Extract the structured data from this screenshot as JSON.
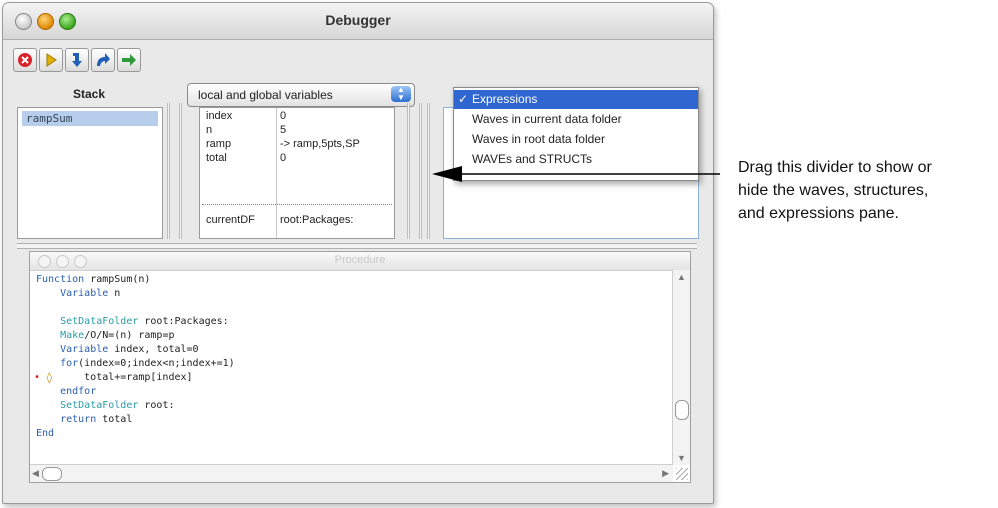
{
  "window": {
    "title": "Debugger"
  },
  "toolbar": {
    "buttons": [
      {
        "icon": "stop-icon",
        "color": "#d8232a"
      },
      {
        "icon": "go-icon",
        "color": "#e0b000"
      },
      {
        "icon": "step-into-icon",
        "color": "#1f5fb5"
      },
      {
        "icon": "step-over-icon",
        "color": "#1f5fb5"
      },
      {
        "icon": "step-out-icon",
        "color": "#2f9a3a"
      }
    ]
  },
  "stack": {
    "header": "Stack",
    "items": [
      "rampSum"
    ]
  },
  "variables": {
    "popup_value": "local and global variables",
    "rows": [
      {
        "name": "index",
        "value": "0"
      },
      {
        "name": "n",
        "value": "5"
      },
      {
        "name": "ramp",
        "value": "-> ramp,5pts,SP"
      },
      {
        "name": "total",
        "value": "0"
      },
      {
        "name": "currentDF",
        "value": "root:Packages:"
      }
    ]
  },
  "pane_menu": {
    "items": [
      {
        "label": "Expressions",
        "checked": true
      },
      {
        "label": "Waves in current data folder",
        "checked": false
      },
      {
        "label": "Waves in root data folder",
        "checked": false
      },
      {
        "label": "WAVEs and STRUCTs",
        "checked": false
      }
    ],
    "check_mark": "✓"
  },
  "procedure": {
    "title": "Procedure",
    "lines": [
      "Function rampSum(n)",
      "    Variable n",
      "",
      "    SetDataFolder root:Packages:",
      "    Make/O/N=(n) ramp=p",
      "    Variable index, total=0",
      "    for(index=0;index<n;index+=1)",
      "        total+=ramp[index]",
      "    endfor",
      "    SetDataFolder root:",
      "    return total",
      "End"
    ],
    "breakpoint_marker": "•",
    "pc_marker": "◊"
  },
  "annotation": {
    "lines": [
      "Drag this divider to show or",
      "hide the waves, structures,",
      "and expressions pane."
    ]
  }
}
